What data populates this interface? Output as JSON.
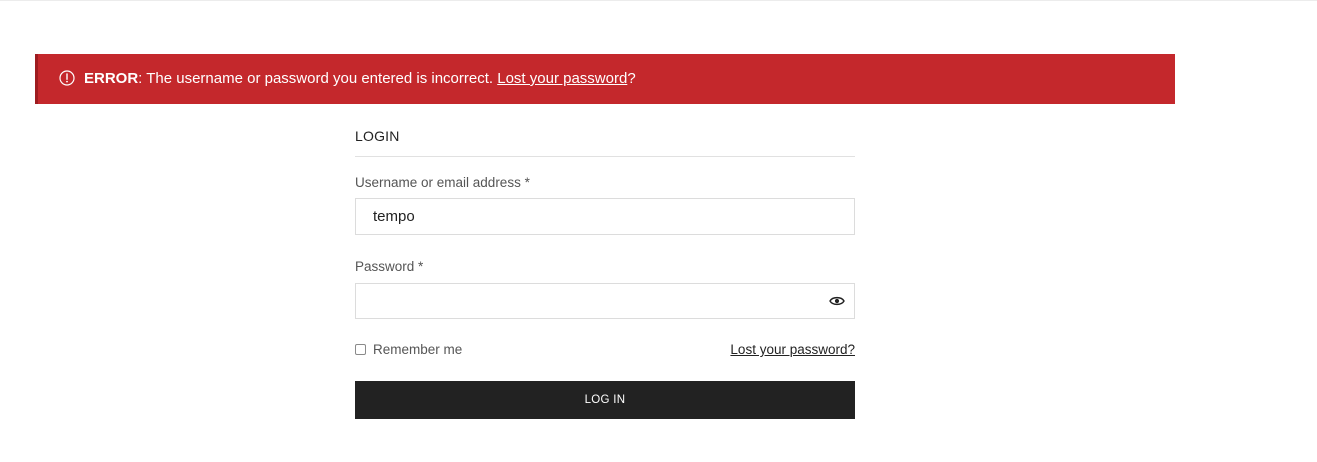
{
  "error": {
    "icon": "alert-circle-icon",
    "strong": "ERROR",
    "message": ": The username or password you entered is incorrect. ",
    "link": "Lost your password",
    "suffix": "?",
    "background": "#c4282c"
  },
  "form": {
    "title": "LOGIN",
    "username_label": "Username or email address *",
    "username_value": "tempo",
    "password_label": "Password *",
    "password_value": "",
    "show_password_icon": "eye-icon",
    "remember_label": "Remember me",
    "remember_checked": false,
    "lost_password_link": "Lost your password?",
    "submit_label": "LOG IN",
    "submit_background": "#222222"
  }
}
